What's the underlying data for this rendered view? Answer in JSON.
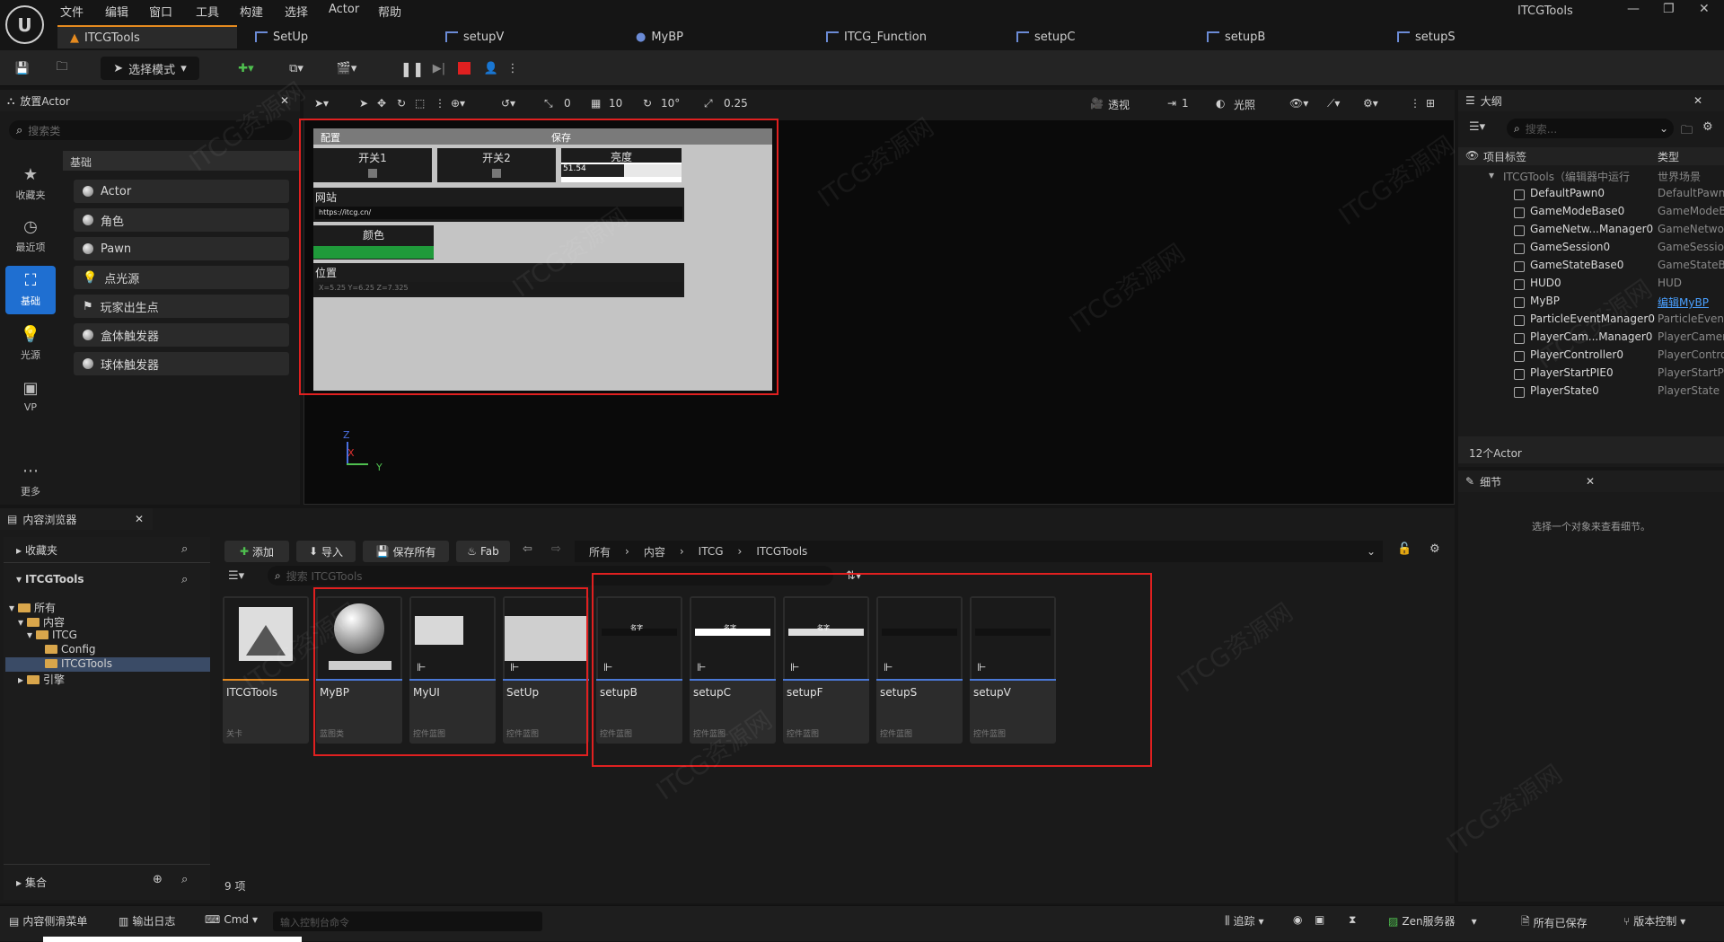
{
  "menu": [
    "文件",
    "编辑",
    "窗口",
    "工具",
    "构建",
    "选择",
    "Actor",
    "帮助"
  ],
  "app_title": "ITCGTools",
  "tabs": [
    {
      "label": "ITCGTools"
    },
    {
      "label": "SetUp"
    },
    {
      "label": "setupV"
    },
    {
      "label": "MyBP"
    },
    {
      "label": "ITCG_Function"
    },
    {
      "label": "setupC"
    },
    {
      "label": "setupB"
    },
    {
      "label": "setupS"
    }
  ],
  "toolbar": {
    "mode_label": "选择模式"
  },
  "place_actor": {
    "title": "放置Actor",
    "search_placeholder": "搜索类",
    "category": "基础",
    "nav": [
      "收藏夹",
      "最近项",
      "基础",
      "光源",
      "VP",
      "更多"
    ],
    "items": [
      "Actor",
      "角色",
      "Pawn",
      "点光源",
      "玩家出生点",
      "盒体触发器",
      "球体触发器"
    ]
  },
  "viewport": {
    "grid_snap": "10",
    "rot_snap": "10°",
    "scale_snap": "0.25",
    "cam_snap": "0",
    "view_mode": "透视",
    "lighting": "光照",
    "speed": "1",
    "axis_z": "Z",
    "axis_x": "X",
    "axis_y": "Y"
  },
  "ui_widget": {
    "header_left": "配置",
    "header_center": "保存",
    "switch1": "开关1",
    "switch2": "开关2",
    "brightness_label": "亮度",
    "brightness_value": "51.54",
    "brightness_level": 0.52,
    "website_label": "网站",
    "website_value": "https://itcg.cn/",
    "color_label": "颜色",
    "color_value": "#1f9a3a",
    "position_label": "位置",
    "position_value": "X=5.25 Y=6.25 Z=7.325"
  },
  "outliner": {
    "title": "大纲",
    "search_placeholder": "搜索...",
    "col_label": "项目标签",
    "col_type": "类型",
    "root_label": "ITCGTools（编辑器中运行",
    "root_type": "世界场景",
    "rows": [
      {
        "name": "DefaultPawn0",
        "type": "DefaultPawn"
      },
      {
        "name": "GameModeBase0",
        "type": "GameModeBase"
      },
      {
        "name": "GameNetw...Manager0",
        "type": "GameNetworkManager"
      },
      {
        "name": "GameSession0",
        "type": "GameSession"
      },
      {
        "name": "GameStateBase0",
        "type": "GameStateBase"
      },
      {
        "name": "HUD0",
        "type": "HUD"
      },
      {
        "name": "MyBP",
        "type": "编辑MyBP"
      },
      {
        "name": "ParticleEventManager0",
        "type": "ParticleEventManager"
      },
      {
        "name": "PlayerCam...Manager0",
        "type": "PlayerCameraManager"
      },
      {
        "name": "PlayerController0",
        "type": "PlayerController"
      },
      {
        "name": "PlayerStartPIE0",
        "type": "PlayerStartPIE"
      },
      {
        "name": "PlayerState0",
        "type": "PlayerState"
      }
    ],
    "count": "12个Actor"
  },
  "details": {
    "title": "细节",
    "empty": "选择一个对象来查看细节。"
  },
  "content_browser": {
    "title": "内容浏览器",
    "favorites": "收藏夹",
    "project": "ITCGTools",
    "tree": [
      "所有",
      "内容",
      "ITCG",
      "Config",
      "ITCGTools",
      "引擎"
    ],
    "collections": "集合",
    "add": "添加",
    "import": "导入",
    "save_all": "保存所有",
    "fab": "Fab",
    "breadcrumb": [
      "所有",
      "内容",
      "ITCG",
      "ITCGTools"
    ],
    "search_placeholder": "搜索 ITCGTools",
    "item_count": "9 项",
    "assets": [
      {
        "name": "ITCGTools",
        "type": "关卡"
      },
      {
        "name": "MyBP",
        "type": "蓝图类"
      },
      {
        "name": "MyUI",
        "type": "控件蓝图"
      },
      {
        "name": "SetUp",
        "type": "控件蓝图"
      },
      {
        "name": "setupB",
        "type": "控件蓝图"
      },
      {
        "name": "setupC",
        "type": "控件蓝图"
      },
      {
        "name": "setupF",
        "type": "控件蓝图"
      },
      {
        "name": "setupS",
        "type": "控件蓝图"
      },
      {
        "name": "setupV",
        "type": "控件蓝图"
      }
    ],
    "thumb_label": "名字"
  },
  "statusbar": {
    "drawer": "内容侧滑菜单",
    "output": "输出日志",
    "cmd": "Cmd",
    "cmd_placeholder": "输入控制台命令",
    "trace": "追踪",
    "zen": "Zen服务器",
    "saved": "所有已保存",
    "vcs": "版本控制"
  },
  "watermark": "ITCG资源网"
}
